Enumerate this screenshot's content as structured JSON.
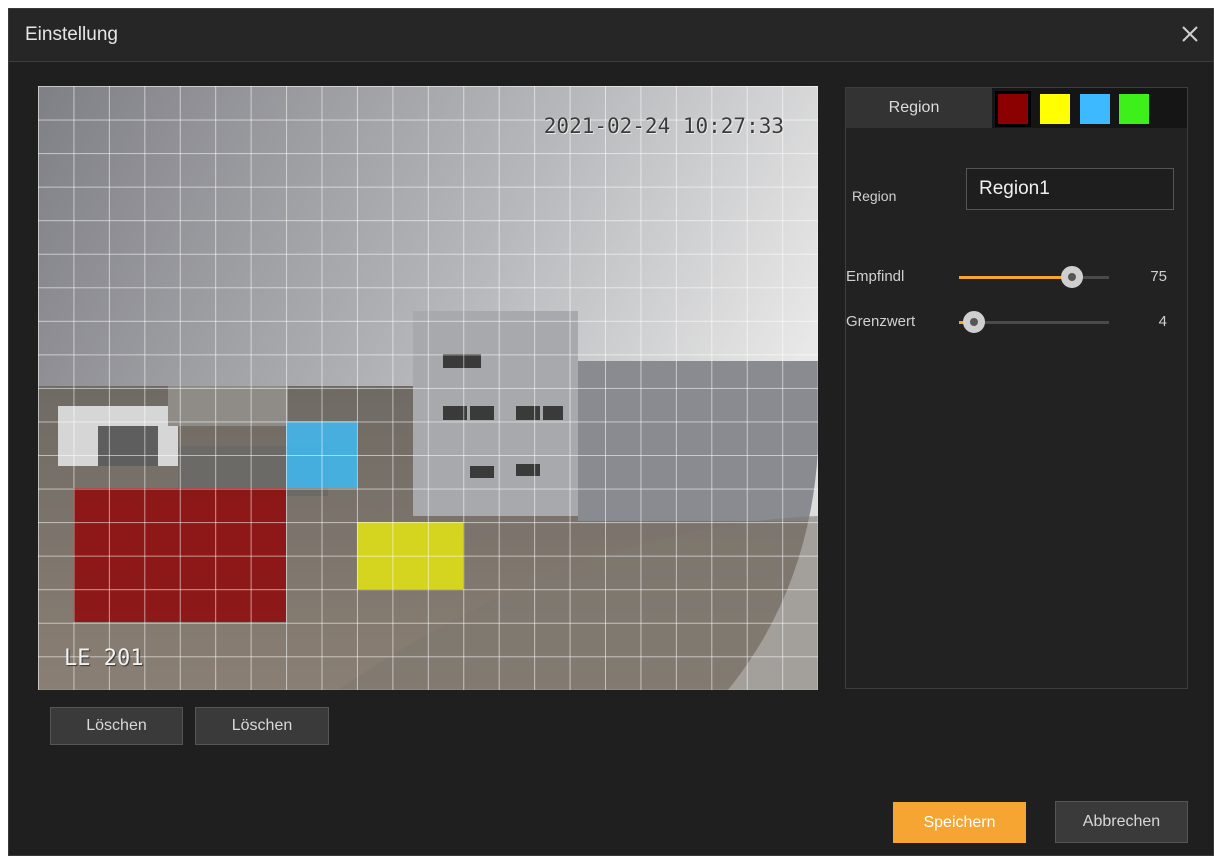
{
  "dialog": {
    "title": "Einstellung",
    "close_icon": "close-icon"
  },
  "camera": {
    "timestamp": "2021-02-24 10:27:33",
    "channel_name": "LE 201",
    "zones": [
      {
        "name": "zone-red",
        "color": "#8e1010"
      },
      {
        "name": "zone-blue",
        "color": "#43b4e8"
      },
      {
        "name": "zone-yellow",
        "color": "#dcdc18"
      }
    ]
  },
  "camera_buttons": {
    "clear_1": "Löschen",
    "clear_2": "Löschen"
  },
  "panel": {
    "tab_label": "Region",
    "swatches": [
      {
        "name": "red",
        "color": "#8b0000",
        "selected": true
      },
      {
        "name": "yellow",
        "color": "#ffff00",
        "selected": false
      },
      {
        "name": "blue",
        "color": "#3cb9ff",
        "selected": false
      },
      {
        "name": "green",
        "color": "#3ef01a",
        "selected": false
      }
    ],
    "region_label": "Region",
    "region_value": "Region1",
    "sensitivity": {
      "label": "Empfindl",
      "value": 75,
      "fraction": 0.75
    },
    "threshold": {
      "label": "Grenzwert",
      "value": 4,
      "fraction": 0.1
    }
  },
  "footer": {
    "save": "Speichern",
    "cancel": "Abbrechen"
  },
  "colors": {
    "accent": "#f6a532",
    "dialog_bg": "#1f1f1f"
  }
}
